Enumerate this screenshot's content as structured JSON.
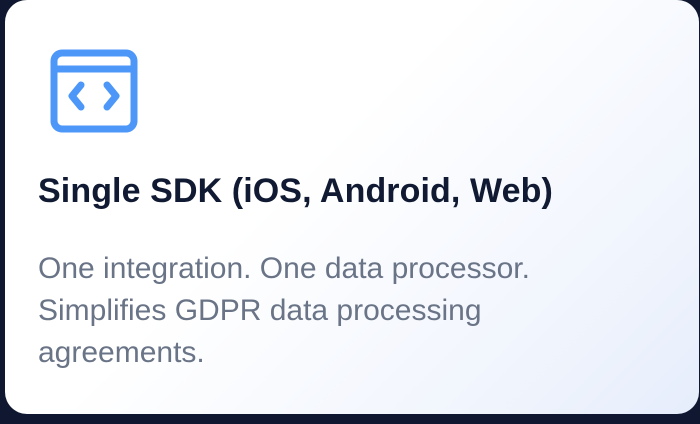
{
  "card": {
    "icon": "code-window-icon",
    "title": "Single SDK (iOS, Android, Web)",
    "description": "One integration. One data processor. Simplifies GDPR data processing agreements."
  },
  "colors": {
    "accent": "#4d97f8",
    "title": "#111a33",
    "body_text": "#6a7487",
    "background": "#0f1830"
  }
}
